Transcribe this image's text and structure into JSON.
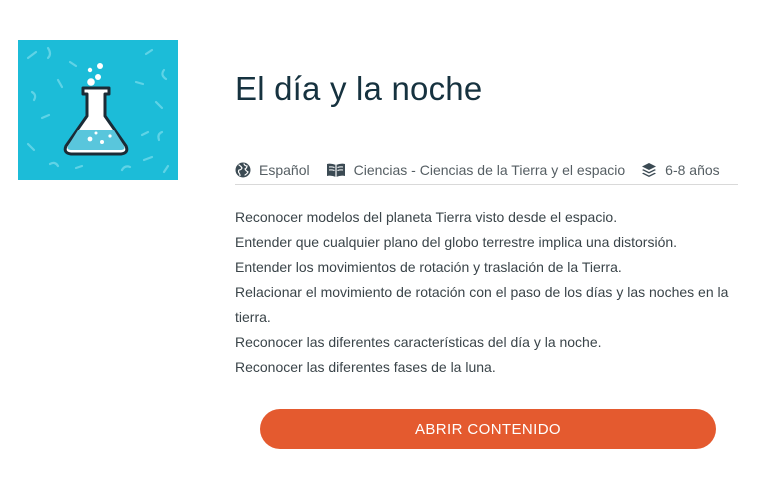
{
  "resource": {
    "title": "El día y la noche",
    "thumbnail_icon": "flask-icon",
    "thumbnail_color": "#1cbcd8"
  },
  "meta": {
    "language": "Español",
    "language_icon": "globe-icon",
    "subject": "Ciencias - Ciencias de la Tierra y el espacio",
    "subject_icon": "book-icon",
    "age": "6-8 años",
    "age_icon": "layers-icon"
  },
  "objectives": [
    "Reconocer modelos del planeta Tierra visto desde el espacio.",
    "Entender que cualquier plano del globo terrestre implica una distorsión.",
    "Entender los movimientos de rotación y traslación de la Tierra.",
    "Relacionar el movimiento de rotación con el paso de los días y las noches en la tierra.",
    "Reconocer las diferentes características del día y la noche.",
    "Reconocer las diferentes fases de la luna."
  ],
  "actions": {
    "open_label": "ABRIR CONTENIDO",
    "accent_color": "#e45a2f"
  }
}
